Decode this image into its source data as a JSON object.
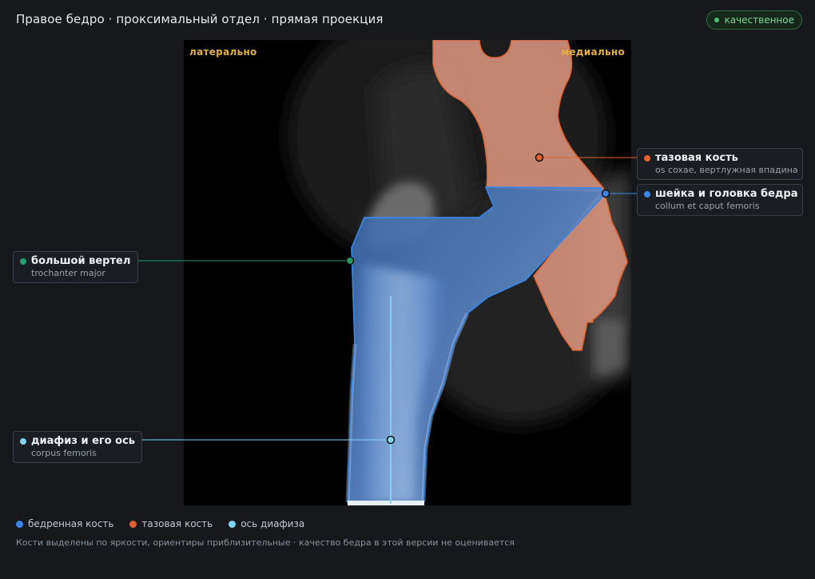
{
  "header": {
    "title": "Правое бедро · проксимальный отдел · прямая проекция",
    "badge": "качественное"
  },
  "viewer": {
    "orientation_left": "латерально",
    "orientation_right": "медиально"
  },
  "annotations": [
    {
      "id": "pelvis",
      "title": "тазовая кость",
      "subtitle": "os coxae, вертлужная впадина",
      "color": "#e0622f"
    },
    {
      "id": "neck",
      "title": "шейка и головка бедра",
      "subtitle": "collum et caput femoris",
      "color": "#3a86e8"
    },
    {
      "id": "trochanter",
      "title": "большой вертел",
      "subtitle": "trochanter major",
      "color": "#22a06b"
    },
    {
      "id": "shaft",
      "title": "диафиз и его ось",
      "subtitle": "corpus femoris",
      "color": "#7fd3f7"
    }
  ],
  "legend": [
    {
      "label": "бедренная кость",
      "color": "#3a86e8"
    },
    {
      "label": "тазовая кость",
      "color": "#e0622f"
    },
    {
      "label": "ось диафиза",
      "color": "#7fd3f7"
    }
  ],
  "footnote": "Кости выделены по яркости, ориентиры приблизительные · качество бедра в этой версии не оценивается"
}
